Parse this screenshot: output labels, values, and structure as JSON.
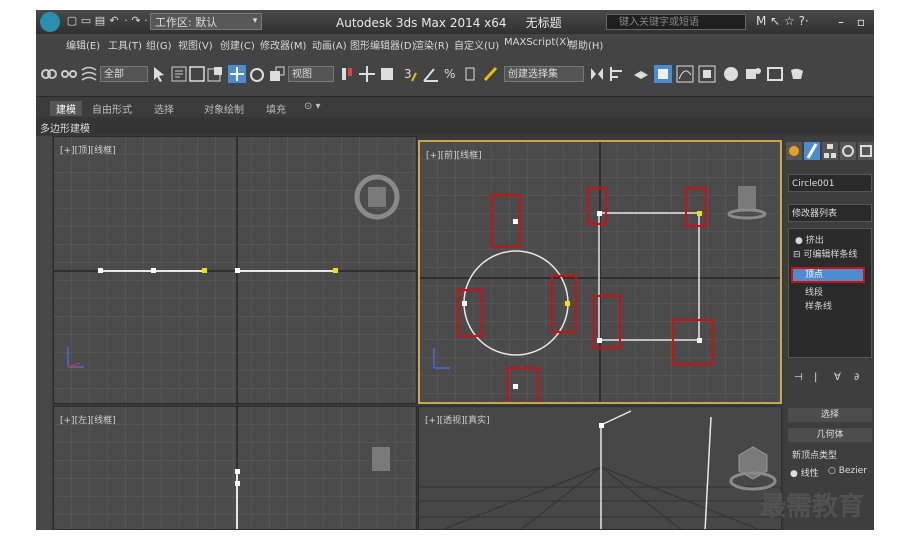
{
  "titlebar": {
    "quick_access": [
      "▢",
      "▭",
      "▤",
      "↶",
      "·",
      "↷",
      "·"
    ],
    "workspace": "工作区: 默认",
    "workspace_arrow": "▾",
    "app_title": "Autodesk 3ds Max  2014 x64",
    "doc_title": "无标题",
    "search_placeholder": "键入关键字或短语",
    "icons": "M ↖ ☆ ?·",
    "minimize": "–",
    "restore": "▫"
  },
  "menu": {
    "items": [
      "编辑(E)",
      "工具(T)",
      "组(G)",
      "视图(V)",
      "创建(C)",
      "修改器(M)",
      "动画(A)",
      "图形编辑器(D)",
      "渲染(R)",
      "自定义(U)",
      "MAXScript(X)",
      "帮助(H)"
    ]
  },
  "toolbar": {
    "selection_filter": "全部",
    "ref_coord": "视图",
    "named_selection": "创建选择集"
  },
  "ribbon": {
    "tabs": [
      "建模",
      "自由形式",
      "选择",
      "对象绘制",
      "填充",
      "⊙ ▾"
    ],
    "active_tab": 0,
    "sub_panel": "多边形建模"
  },
  "viewports": {
    "top_left_label": "[+][顶][线框]",
    "top_right_label": "[+][前][线框]",
    "bottom_left_label": "[+][左][线框]",
    "bottom_right_label": "[+][透视][真实]"
  },
  "command_panel": {
    "object_name": "Circle001",
    "modifier_list": "修改器列表",
    "stack": [
      "挤出",
      "可编辑样条线",
      "顶点",
      "线段",
      "样条线"
    ],
    "selected_stack_item": "顶点",
    "stack_tool_icons": [
      "⊣",
      "|",
      "∀",
      "∂"
    ],
    "rollouts": [
      "选择",
      "几何体"
    ],
    "new_vertex_type_label": "新顶点类型",
    "vertex_types": [
      "线性",
      "Bezier"
    ]
  },
  "watermark": "最需教育",
  "colors": {
    "highlight_red": "#d01010",
    "selection_blue": "#4d8dcf",
    "active_viewport": "#c9a64b",
    "vertex_yellow": "#f0e000"
  }
}
